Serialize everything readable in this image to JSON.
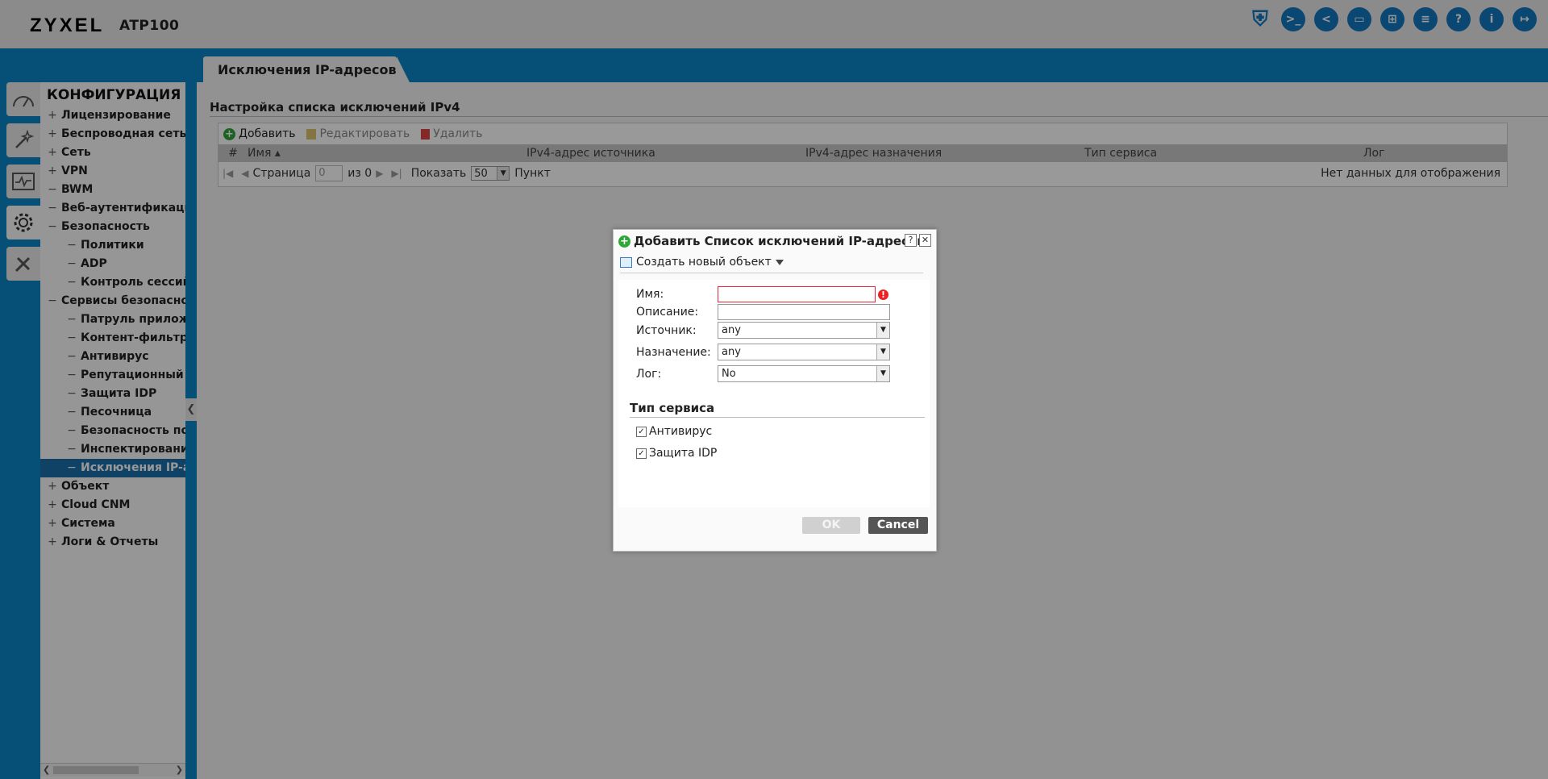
{
  "header": {
    "brand": "ZYXEL",
    "model": "ATP100",
    "icons": [
      {
        "name": "security-shield-icon",
        "glyph": "⛨"
      },
      {
        "name": "console-icon",
        "glyph": ">_"
      },
      {
        "name": "cli-icon",
        "glyph": "<"
      },
      {
        "name": "window-icon",
        "glyph": "▭"
      },
      {
        "name": "network-topology-icon",
        "glyph": "⊞"
      },
      {
        "name": "chat-icon",
        "glyph": "≡"
      },
      {
        "name": "help-icon",
        "glyph": "?"
      },
      {
        "name": "info-icon",
        "glyph": "i"
      },
      {
        "name": "logout-icon",
        "glyph": "↦"
      }
    ]
  },
  "page_tab": "Исключения IP-адресов",
  "nav": {
    "title": "КОНФИГУРАЦИЯ",
    "items": [
      {
        "level": 1,
        "mark": "+",
        "label": "Лицензирование"
      },
      {
        "level": 1,
        "mark": "+",
        "label": "Беспроводная сеть"
      },
      {
        "level": 1,
        "mark": "+",
        "label": "Сеть"
      },
      {
        "level": 1,
        "mark": "+",
        "label": "VPN"
      },
      {
        "level": 1,
        "mark": "−",
        "label": "BWM"
      },
      {
        "level": 1,
        "mark": "−",
        "label": "Веб-аутентификация"
      },
      {
        "level": 1,
        "mark": "−",
        "label": "Безопасность"
      },
      {
        "level": 2,
        "mark": "−",
        "label": "Политики"
      },
      {
        "level": 2,
        "mark": "−",
        "label": "ADP"
      },
      {
        "level": 2,
        "mark": "−",
        "label": "Контроль сессий"
      },
      {
        "level": 1,
        "mark": "−",
        "label": "Сервисы безопасности"
      },
      {
        "level": 2,
        "mark": "−",
        "label": "Патруль приложений"
      },
      {
        "level": 2,
        "mark": "−",
        "label": "Контент-фильтр"
      },
      {
        "level": 2,
        "mark": "−",
        "label": "Антивирус"
      },
      {
        "level": 2,
        "mark": "−",
        "label": "Репутационный фильтр"
      },
      {
        "level": 2,
        "mark": "−",
        "label": "Защита IDP"
      },
      {
        "level": 2,
        "mark": "−",
        "label": "Песочница"
      },
      {
        "level": 2,
        "mark": "−",
        "label": "Безопасность почты"
      },
      {
        "level": 2,
        "mark": "−",
        "label": "Инспектирование SSL"
      },
      {
        "level": 2,
        "mark": "−",
        "label": "Исключения IP-адресов",
        "selected": true
      },
      {
        "level": 1,
        "mark": "+",
        "label": "Объект"
      },
      {
        "level": 1,
        "mark": "+",
        "label": "Cloud CNM"
      },
      {
        "level": 1,
        "mark": "+",
        "label": "Система"
      },
      {
        "level": 1,
        "mark": "+",
        "label": "Логи & Отчеты"
      }
    ]
  },
  "content": {
    "section_title": "Настройка списка исключений IPv4",
    "toolbar": {
      "add": "Добавить",
      "edit": "Редактировать",
      "delete": "Удалить"
    },
    "columns": [
      "#",
      "Имя ▴",
      "IPv4-адрес источника",
      "IPv4-адрес назначения",
      "Тип сервиса",
      "Лог"
    ],
    "pager": {
      "page_label": "Страница",
      "page_value": "0",
      "of_label": "из 0",
      "show_label": "Показать",
      "show_value": "50",
      "items_label": "Пункт",
      "no_data": "Нет данных для отображения"
    }
  },
  "modal": {
    "title": "Добавить Список исключений IP-адресов",
    "help": "?",
    "close": "✕",
    "create_object": "Создать новый объект",
    "fields": {
      "name_label": "Имя:",
      "name_value": "",
      "desc_label": "Описание:",
      "desc_value": "",
      "source_label": "Источник:",
      "source_value": "any",
      "dest_label": "Назначение:",
      "dest_value": "any",
      "log_label": "Лог:",
      "log_value": "No"
    },
    "service_type_title": "Тип сервиса",
    "checkboxes": [
      {
        "label": "Антивирус",
        "checked": true
      },
      {
        "label": "Защита IDP",
        "checked": true
      }
    ],
    "ok": "OK",
    "cancel": "Cancel"
  },
  "colors": {
    "accent_blue": "#0a86c8",
    "selected_nav": "#1a6fa8",
    "add_green": "#2fa638",
    "error_red": "#e22222"
  }
}
